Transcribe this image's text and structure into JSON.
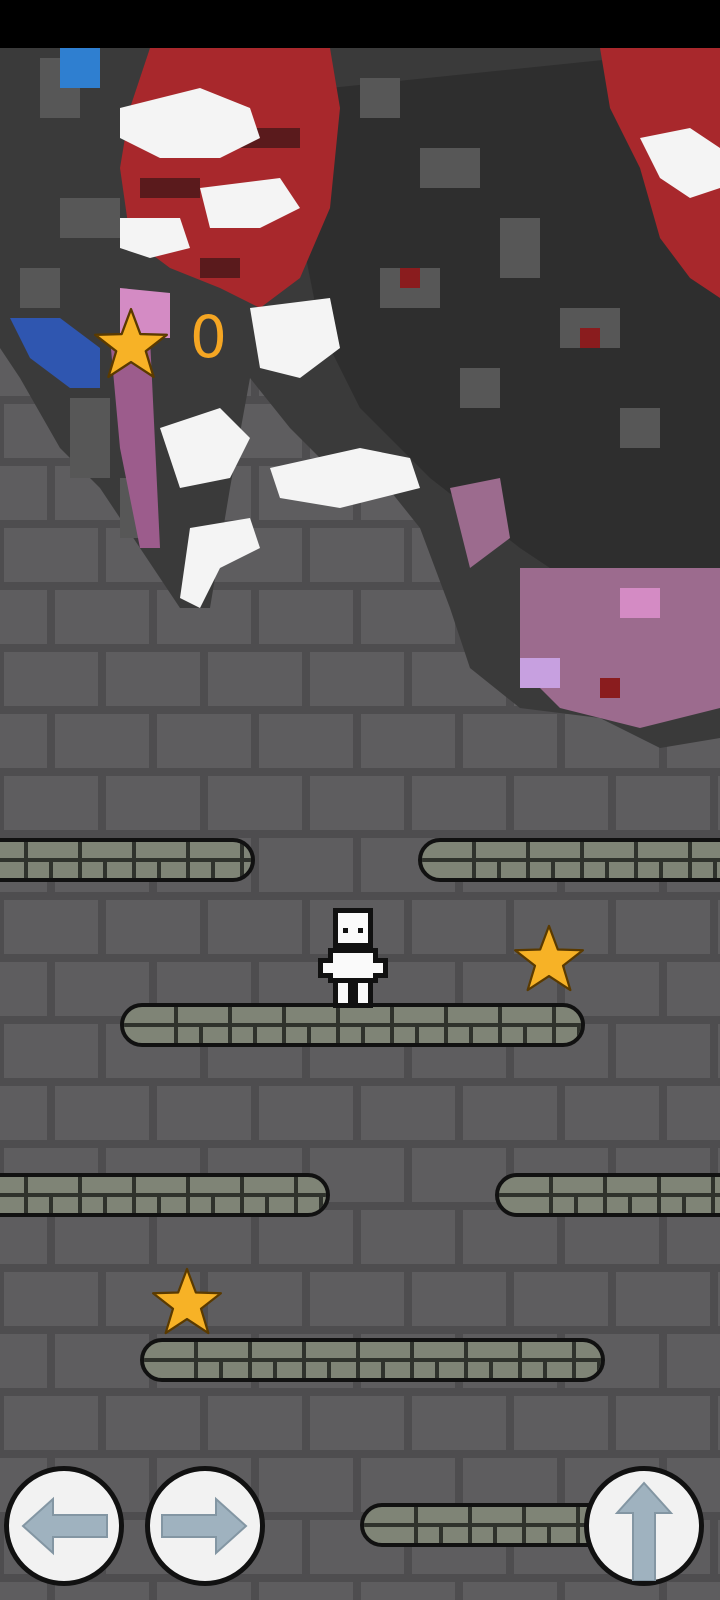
{
  "hud": {
    "score": "0",
    "star_icon": "star-icon",
    "accent_color": "#f5a623"
  },
  "controls": {
    "left_icon": "arrow-left-icon",
    "right_icon": "arrow-right-icon",
    "jump_icon": "arrow-up-icon"
  },
  "colors": {
    "wall": "#5e5d5f",
    "mortar": "#4e4d4f",
    "platform": "#7f8476",
    "boss_red": "#a8282c",
    "boss_dark": "#333333"
  }
}
